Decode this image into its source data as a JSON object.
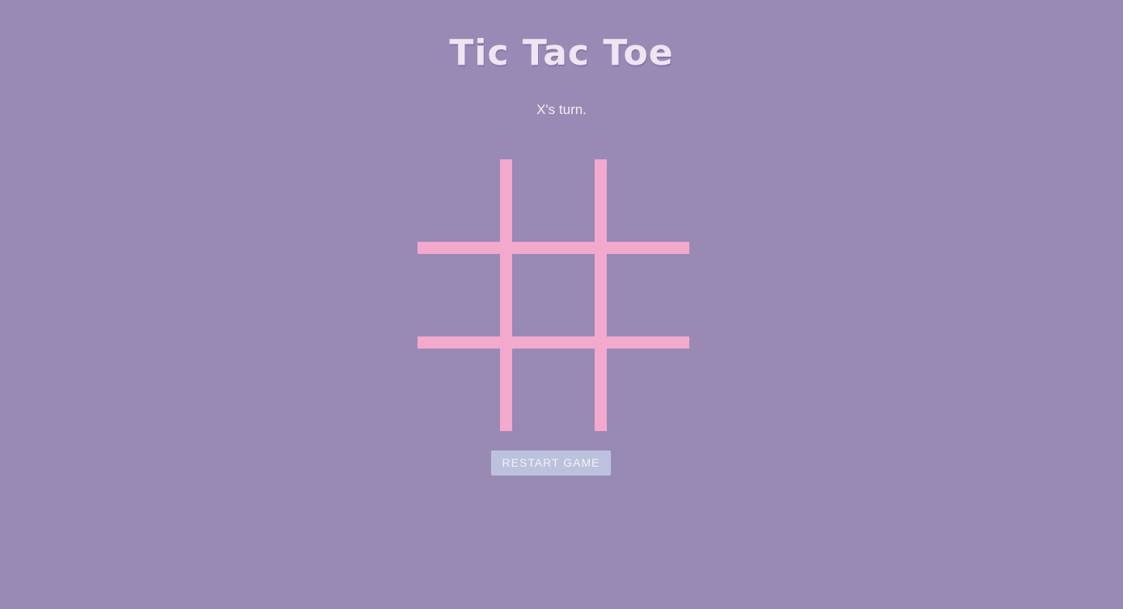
{
  "game": {
    "title": "Tic Tac Toe",
    "status": "X's turn.",
    "restart_label": "RESTART GAME",
    "board": [
      "",
      "",
      "",
      "",
      "",
      "",
      "",
      "",
      ""
    ],
    "colors": {
      "background": "#998ab5",
      "grid_lines": "#f2a9cc",
      "button": "#bcc2dd",
      "text": "#efe4f2"
    }
  }
}
